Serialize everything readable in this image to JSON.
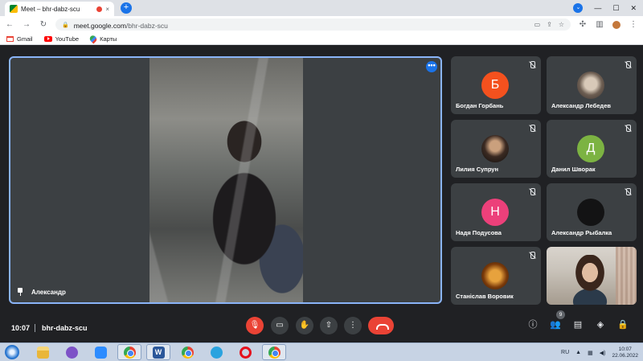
{
  "browser": {
    "tab_title": "Meet – bhr-dabz-scu",
    "tab_close": "×",
    "new_tab": "+",
    "url_host": "meet.google.com",
    "url_path": "/bhr-dabz-scu",
    "bookmarks": [
      {
        "label": "Gmail"
      },
      {
        "label": "YouTube"
      },
      {
        "label": "Карты"
      }
    ]
  },
  "meet": {
    "main_participant": "Александр",
    "more_options": "•••",
    "participants": [
      {
        "name": "Богдан Горбань",
        "initial": "Б",
        "color": "#f4511e"
      },
      {
        "name": "Александр Лебедев",
        "initial": ""
      },
      {
        "name": "Лилия Супрун",
        "initial": ""
      },
      {
        "name": "Данил Шворак",
        "initial": "Д",
        "color": "#7cb342"
      },
      {
        "name": "Надя Подусова",
        "initial": "Н",
        "color": "#ec407a"
      },
      {
        "name": "Александр Рыбалка",
        "initial": ""
      },
      {
        "name": "Станіслав Воровик",
        "initial": ""
      },
      {
        "name": "",
        "initial": ""
      }
    ],
    "people_count": "9",
    "time": "10:07",
    "meeting_code": "bhr-dabz-scu"
  },
  "taskbar": {
    "lang": "RU",
    "time": "10:07",
    "date": "22.06.2022"
  }
}
